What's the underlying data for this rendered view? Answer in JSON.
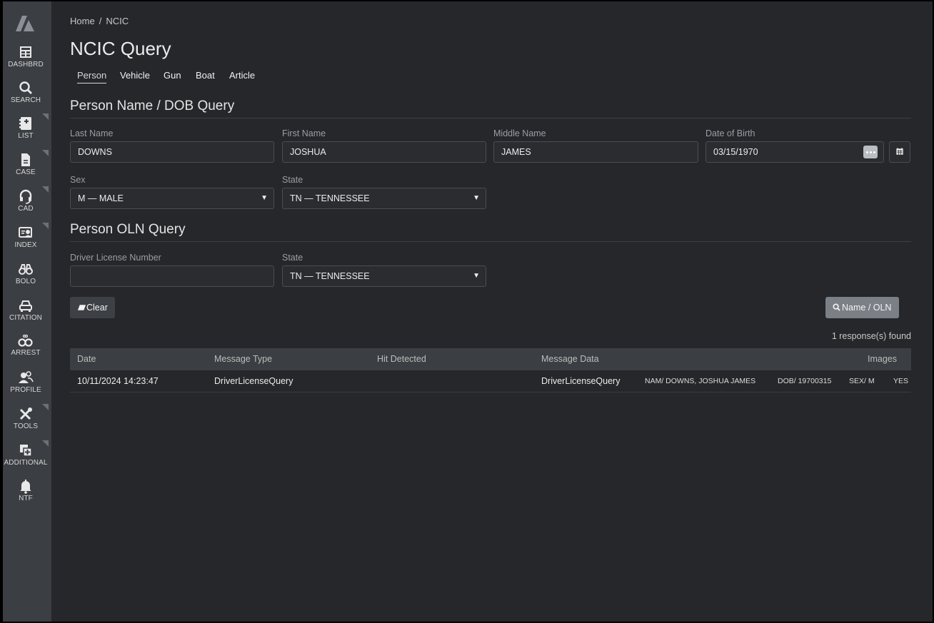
{
  "sidebar": {
    "items": [
      {
        "label": "DASHBRD",
        "icon": "dashboard-icon"
      },
      {
        "label": "SEARCH",
        "icon": "search-icon"
      },
      {
        "label": "LIST",
        "icon": "list-icon"
      },
      {
        "label": "CASE",
        "icon": "case-icon"
      },
      {
        "label": "CAD",
        "icon": "headset-icon"
      },
      {
        "label": "INDEX",
        "icon": "index-icon"
      },
      {
        "label": "BOLO",
        "icon": "binoculars-icon"
      },
      {
        "label": "CITATION",
        "icon": "car-icon"
      },
      {
        "label": "ARREST",
        "icon": "handcuffs-icon"
      },
      {
        "label": "PROFILE",
        "icon": "profile-icon"
      },
      {
        "label": "TOOLS",
        "icon": "tools-icon"
      },
      {
        "label": "ADDITIONAL",
        "icon": "additional-icon"
      },
      {
        "label": "NTF",
        "icon": "bell-icon"
      }
    ]
  },
  "breadcrumb": {
    "home": "Home",
    "separator": "/",
    "current": "NCIC"
  },
  "page_title": "NCIC Query",
  "tabs": [
    "Person",
    "Vehicle",
    "Gun",
    "Boat",
    "Article"
  ],
  "active_tab": "Person",
  "name_dob_section": {
    "title": "Person Name / DOB Query",
    "last_name_label": "Last Name",
    "last_name_value": "DOWNS",
    "first_name_label": "First Name",
    "first_name_value": "JOSHUA",
    "middle_name_label": "Middle Name",
    "middle_name_value": "JAMES",
    "dob_label": "Date of Birth",
    "dob_value": "03/15/1970",
    "sex_label": "Sex",
    "sex_value": "M — MALE",
    "state_label": "State",
    "state_value": "TN — TENNESSEE"
  },
  "oln_section": {
    "title": "Person OLN Query",
    "dl_label": "Driver License Number",
    "dl_value": "",
    "state_label": "State",
    "state_value": "TN — TENNESSEE"
  },
  "buttons": {
    "clear": "Clear",
    "query": "Name / OLN"
  },
  "responses_text": "1 response(s) found",
  "results_table": {
    "headers": [
      "Date",
      "Message Type",
      "Hit Detected",
      "Message Data",
      "Images"
    ],
    "rows": [
      {
        "date": "10/11/2024 14:23:47",
        "message_type": "DriverLicenseQuery",
        "hit_detected": "",
        "message_data": "DriverLicenseQuery",
        "nam": "NAM/ DOWNS, JOSHUA JAMES",
        "dob": "DOB/ 19700315",
        "sex": "SEX/ M",
        "images": "YES"
      }
    ]
  },
  "colors": {
    "background": "#25272a",
    "sidebar": "#3b3e42",
    "query_button": "#7b8087"
  }
}
